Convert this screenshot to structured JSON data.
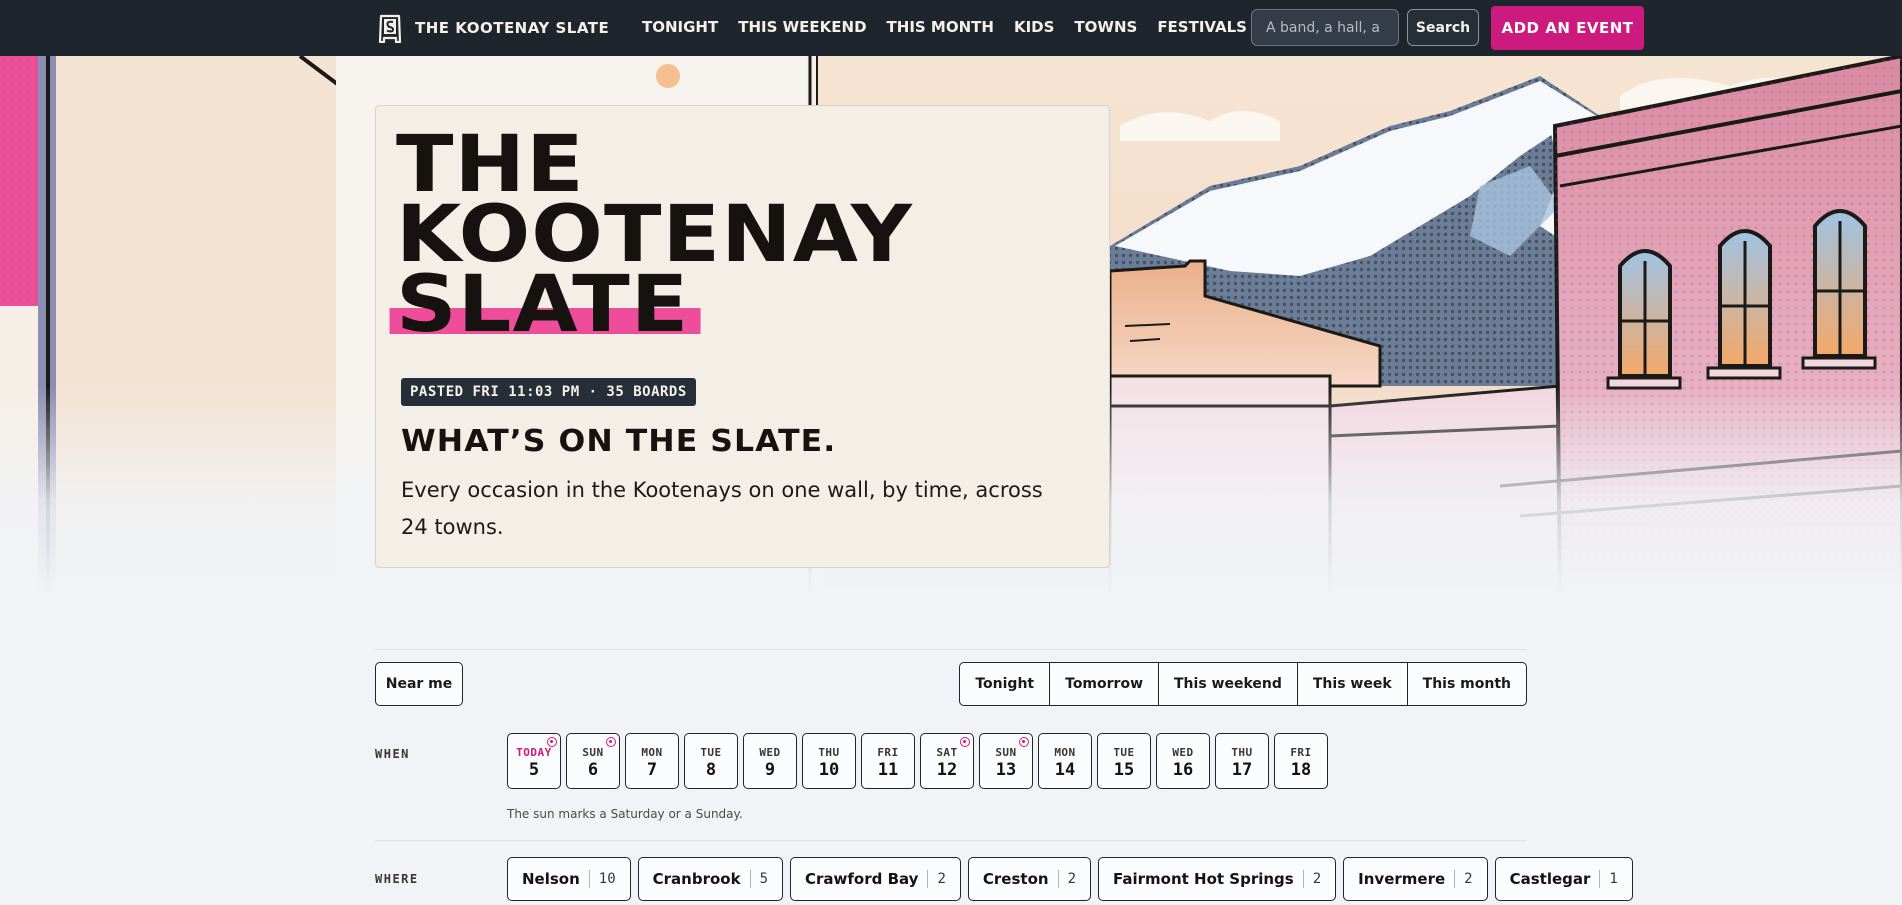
{
  "nav": {
    "brand": "THE KOOTENAY SLATE",
    "links": [
      "TONIGHT",
      "THIS WEEKEND",
      "THIS MONTH",
      "KIDS",
      "TOWNS",
      "FESTIVALS"
    ],
    "search_placeholder": "A band, a hall, a",
    "search_button": "Search",
    "add_event": "ADD AN EVENT"
  },
  "hero": {
    "title_lines": [
      "THE",
      "KOOTENAY",
      "SLATE"
    ],
    "badge": "PASTED FRI 11:03 PM · 35 BOARDS",
    "subtitle": "WHAT’S ON THE SLATE.",
    "description": "Every occasion in the Kootenays on one wall, by time, across 24 towns."
  },
  "filters": {
    "near_me": "Near me",
    "ranges": [
      "Tonight",
      "Tomorrow",
      "This weekend",
      "This week",
      "This month"
    ],
    "when_label": "WHEN",
    "days": [
      {
        "dow": "TODAY",
        "num": "5",
        "today": true,
        "weekend": true
      },
      {
        "dow": "SUN",
        "num": "6",
        "weekend": true
      },
      {
        "dow": "MON",
        "num": "7"
      },
      {
        "dow": "TUE",
        "num": "8"
      },
      {
        "dow": "WED",
        "num": "9"
      },
      {
        "dow": "THU",
        "num": "10"
      },
      {
        "dow": "FRI",
        "num": "11"
      },
      {
        "dow": "SAT",
        "num": "12",
        "weekend": true
      },
      {
        "dow": "SUN",
        "num": "13",
        "weekend": true
      },
      {
        "dow": "MON",
        "num": "14"
      },
      {
        "dow": "TUE",
        "num": "15"
      },
      {
        "dow": "WED",
        "num": "16"
      },
      {
        "dow": "THU",
        "num": "17"
      },
      {
        "dow": "FRI",
        "num": "18"
      }
    ],
    "sun_note": "The sun marks a Saturday or a Sunday.",
    "where_label": "WHERE",
    "towns": [
      {
        "name": "Nelson",
        "count": "10"
      },
      {
        "name": "Cranbrook",
        "count": "5"
      },
      {
        "name": "Crawford Bay",
        "count": "2"
      },
      {
        "name": "Creston",
        "count": "2"
      },
      {
        "name": "Fairmont Hot Springs",
        "count": "2"
      },
      {
        "name": "Invermere",
        "count": "2"
      },
      {
        "name": "Castlegar",
        "count": "1"
      }
    ]
  },
  "colors": {
    "nav_bg": "#1e252d",
    "accent": "#cc1a7e",
    "highlight": "#ee4d9b",
    "card_bg": "#f4efe6",
    "page_bg": "#f1f3f6"
  },
  "icons": [
    "slate-logo-icon",
    "sun-weekend-icon"
  ]
}
